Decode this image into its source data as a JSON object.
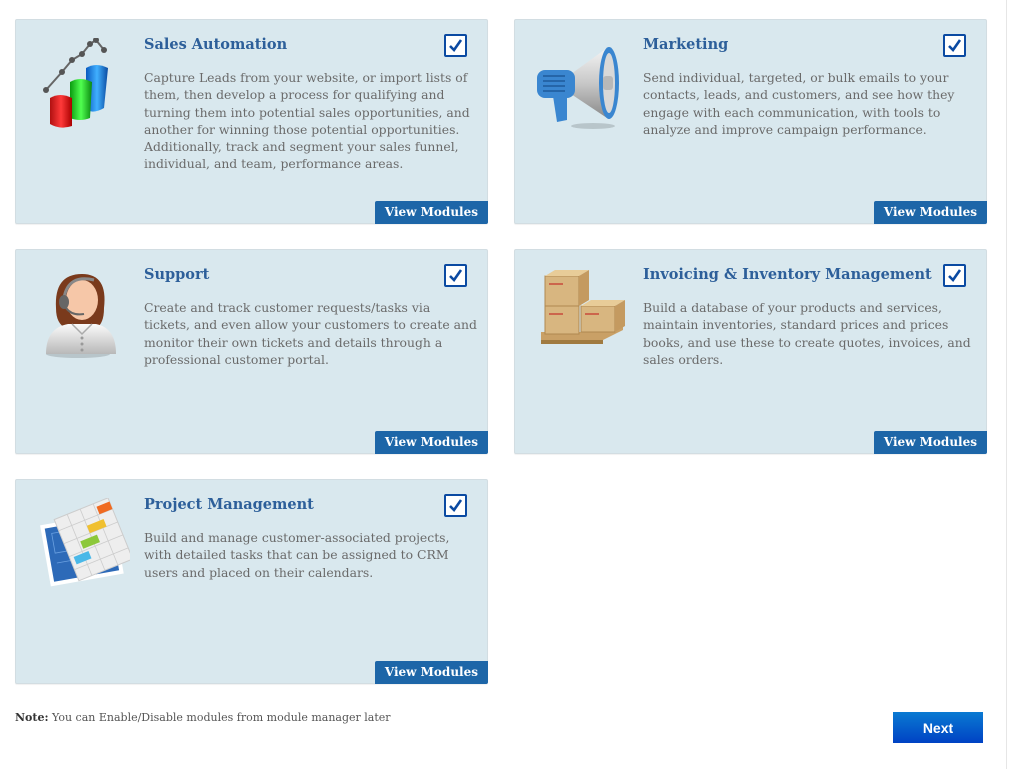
{
  "modules": [
    {
      "id": "sales-automation",
      "icon": "sales-chart-icon",
      "title": "Sales Automation",
      "description": "Capture Leads from your website, or import lists of them, then develop a process for qualifying and turning them into potential sales opportunities, and another for winning those potential opportunities. Additionally, track and segment your sales funnel, individual, and team, performance areas.",
      "checked": true,
      "button_label": "View Modules"
    },
    {
      "id": "marketing",
      "icon": "megaphone-icon",
      "title": "Marketing",
      "description": "Send individual, targeted, or bulk emails to your contacts, leads, and customers, and see how they engage with each communication, with tools to analyze and improve campaign performance.",
      "checked": true,
      "button_label": "View Modules"
    },
    {
      "id": "support",
      "icon": "support-agent-icon",
      "title": "Support",
      "description": "Create and track customer requests/tasks via tickets, and even allow your customers to create and monitor their own tickets and details through a professional customer portal.",
      "checked": true,
      "button_label": "View Modules"
    },
    {
      "id": "invoicing-inventory",
      "icon": "boxes-pallet-icon",
      "title": "Invoicing & Inventory Management",
      "description": "Build a database of your products and services, maintain inventories, standard prices and prices books, and use these to create quotes, invoices, and sales orders.",
      "checked": true,
      "button_label": "View Modules"
    },
    {
      "id": "project-management",
      "icon": "project-gantt-icon",
      "title": "Project Management",
      "description": "Build and manage customer-associated projects, with detailed tasks that can be assigned to CRM users and placed on their calendars.",
      "checked": true,
      "button_label": "View Modules"
    }
  ],
  "footer": {
    "note_label": "Note:",
    "note_text": " You can Enable/Disable modules from module manager later",
    "next_label": "Next"
  },
  "colors": {
    "card_bg": "#d9e8ee",
    "title": "#2d5f9a",
    "view_button": "#1d66a8",
    "checkbox": "#0b4aa2",
    "next_button_top": "#0a7ad2",
    "next_button_bottom": "#0042c4"
  }
}
